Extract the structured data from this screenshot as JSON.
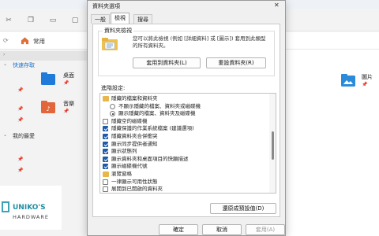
{
  "explorer": {
    "address": "常用",
    "nav": {
      "quick_access": "快速存取",
      "onedrive": "我的最愛"
    },
    "folders": [
      {
        "label": "桌面"
      },
      {
        "label": "音樂"
      },
      {
        "label": "圖片"
      }
    ]
  },
  "dialog": {
    "title": "資料夾選項",
    "close_glyph": "✕",
    "tabs": [
      {
        "label": "一般"
      },
      {
        "label": "檢視"
      },
      {
        "label": "搜尋"
      }
    ],
    "folder_view": {
      "legend": "資料夾檢視",
      "description": "您可以將此檢視 (例如 [詳細資料] 或 [圖示]) 套用到此類型的所有資料夾。",
      "apply_to_all": "套用到資料夾(L)",
      "reset_all": "重設資料夾(R)"
    },
    "advanced_label": "進階設定:",
    "advanced_items": [
      {
        "kind": "folder",
        "indent": 0,
        "text": "隱藏的檔案和資料夾"
      },
      {
        "kind": "radio",
        "indent": 1,
        "checked": false,
        "text": "不顯示隱藏的檔案、資料夾或磁碟機"
      },
      {
        "kind": "radio",
        "indent": 1,
        "checked": true,
        "text": "顯示隱藏的檔案、資料夾及磁碟機"
      },
      {
        "kind": "checkbox",
        "indent": 0,
        "checked": false,
        "text": "隱藏空的磁碟機"
      },
      {
        "kind": "checkbox",
        "indent": 0,
        "checked": true,
        "text": "隱藏保護的作業系統檔案 (建議選項)"
      },
      {
        "kind": "checkbox",
        "indent": 0,
        "checked": true,
        "text": "隱藏資料夾合併衝突"
      },
      {
        "kind": "checkbox",
        "indent": 0,
        "checked": true,
        "text": "顯示同步提供者通知"
      },
      {
        "kind": "checkbox",
        "indent": 0,
        "checked": true,
        "text": "顯示狀態列"
      },
      {
        "kind": "checkbox",
        "indent": 0,
        "checked": true,
        "text": "顯示資料夾和桌面項目的快顯描述"
      },
      {
        "kind": "checkbox",
        "indent": 0,
        "checked": true,
        "text": "顯示磁碟機代號"
      },
      {
        "kind": "folder",
        "indent": 0,
        "text": "瀏覽窗格"
      },
      {
        "kind": "checkbox",
        "indent": 0,
        "checked": false,
        "text": "一律顯示可用性狀態"
      },
      {
        "kind": "checkbox",
        "indent": 0,
        "checked": false,
        "text": "展開到已開啟的資料夾"
      }
    ],
    "restore_defaults": "還原成預設值(D)",
    "ok": "確定",
    "cancel": "取消",
    "apply": "套用(A)"
  },
  "logo": {
    "text_top": "UNIKO'S",
    "text_bottom": "HARDWARE"
  }
}
